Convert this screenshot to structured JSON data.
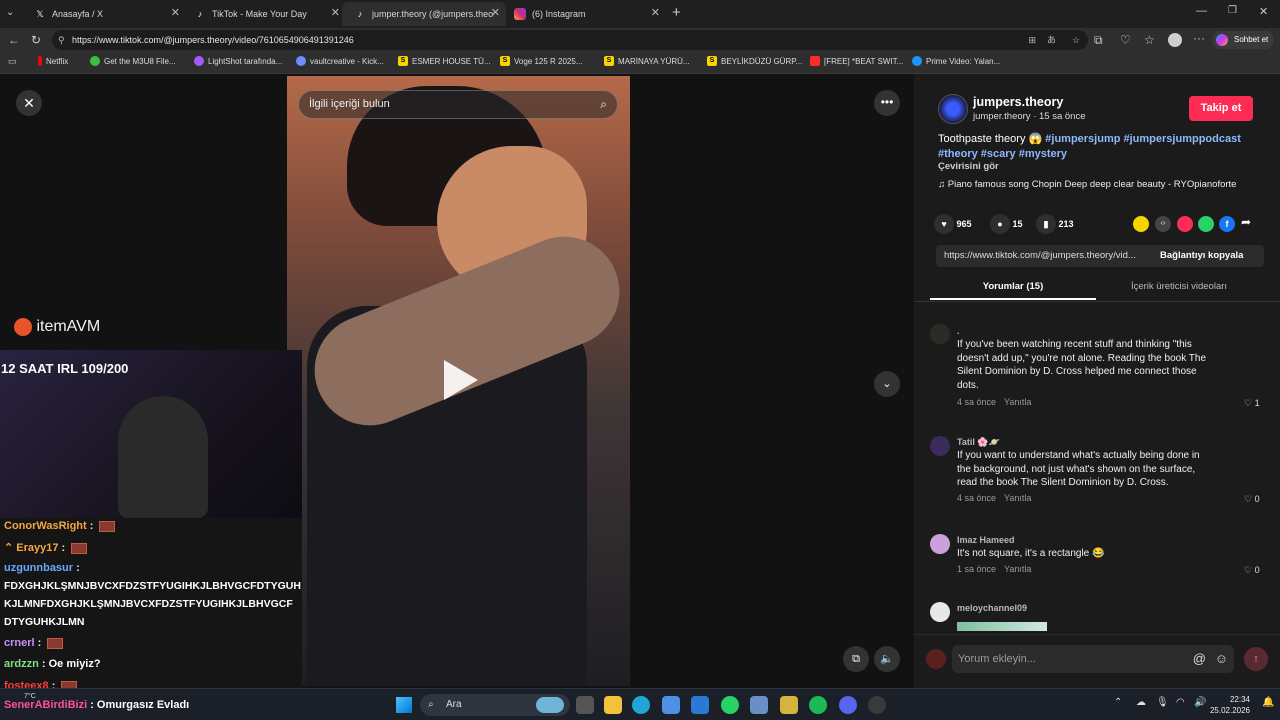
{
  "tabs": [
    {
      "title": "Anasayfa / X",
      "icon": "x-logo"
    },
    {
      "title": "TikTok - Make Your Day",
      "icon": "tiktok-logo"
    },
    {
      "title": "jumper.theory (@jumpers.theory) |",
      "icon": "tiktok-logo",
      "active": true
    },
    {
      "title": "(6) Instagram",
      "icon": "instagram-logo"
    }
  ],
  "address": {
    "url": "https://www.tiktok.com/@jumpers.theory/video/7610654906491391246"
  },
  "copilot": {
    "label": "Sohbet et"
  },
  "bookmarks": [
    {
      "label": "Netflix",
      "color": "#e50914"
    },
    {
      "label": "Get the M3U8 File...",
      "color": "#3fbf3f"
    },
    {
      "label": "LightShot tarafında...",
      "color": "#a259ff"
    },
    {
      "label": "vaultcreative - Kick...",
      "color": "#6c8cff"
    },
    {
      "label": "ESMER HOUSE TÜ...",
      "color": "#f5d400"
    },
    {
      "label": "Voge 125 R 2025...",
      "color": "#f5d400"
    },
    {
      "label": "MARİNAYA YÜRÜ...",
      "color": "#f5d400"
    },
    {
      "label": "BEYLİKDÜZÜ GÜRP...",
      "color": "#f5d400"
    },
    {
      "label": "[FREE] *BEAT SWIT...",
      "color": "#ff2a2a"
    },
    {
      "label": "Prime Video: Yalan...",
      "color": "#1a98ff"
    }
  ],
  "player": {
    "search_placeholder": "İlgili içeriği bulun",
    "watermark": "itemAVM"
  },
  "stream": {
    "title": "12 SAAT IRL 109/200",
    "chat": [
      {
        "user": "ConorWasRight",
        "msg": "",
        "color": "#f4a640",
        "emote": true
      },
      {
        "user": "Erayy17",
        "msg": "",
        "color": "#f4a640",
        "emote": true
      },
      {
        "user": "uzgunnbasur",
        "msg": "",
        "color": "#6aa8ff",
        "emote": false
      },
      {
        "user": "",
        "msg": "FDXGHJKLŞMNJBVCXFDZSTFYUGIHKJLBHVGCFDTYGUH",
        "color": "#ffffff",
        "emote": false
      },
      {
        "user": "",
        "msg": "KJLMNFDXGHJKLŞMNJBVCXFDZSTFYUGIHKJLBHVGCF",
        "color": "#ffffff",
        "emote": false
      },
      {
        "user": "",
        "msg": "DTYGUHKJLMN",
        "color": "#ffffff",
        "emote": false
      },
      {
        "user": "crnerl",
        "msg": "",
        "color": "#c88cff",
        "emote": true
      },
      {
        "user": "ardzzn",
        "msg": "Oe miyiz?",
        "color": "#7fe07f",
        "emote": false
      },
      {
        "user": "fosteex8",
        "msg": "",
        "color": "#ff3b3b",
        "emote": true
      },
      {
        "user": "SenerABirdiBizi",
        "msg": "Omurgasız Evladı",
        "color": "#ff4fa0",
        "emote": false
      }
    ]
  },
  "video": {
    "author": "jumpers.theory",
    "handle_time": "jumper.theory · 15 sa önce",
    "follow_label": "Takip et",
    "caption_text": "Toothpaste theory 😱",
    "hashtags_line1": "#jumpersjump #jumpersjumppodcast",
    "hashtags_line2": "#theory #scary #mystery",
    "see_translation": "Çevirisini gör",
    "music": "Piano famous song Chopin Deep deep clear beauty - RYOpianoforte",
    "likes": "965",
    "comments": "15",
    "saves": "213",
    "share_url": "https://www.tiktok.com/@jumpers.theory/vid...",
    "copy_link": "Bağlantıyı kopyala",
    "tab_comments": "Yorumlar (15)",
    "tab_creator": "İçerik üreticisi videoları",
    "comment_placeholder": "Yorum ekleyin..."
  },
  "comments": [
    {
      "name": ".",
      "lines": [
        "If you've been watching recent stuff and thinking \"this",
        "doesn't add up,\" you're not alone. Reading the book The",
        "Silent Dominion by D. Cross helped me connect those",
        "dots."
      ],
      "time": "4 sa önce",
      "reply": "Yanıtla",
      "likes": "1"
    },
    {
      "name": "Tatil 🌸🪐",
      "lines": [
        "If you want to understand what's actually being done in",
        "the background, not just what's shown on the surface,",
        "read the book The Silent Dominion by D. Cross."
      ],
      "time": "4 sa önce",
      "reply": "Yanıtla",
      "likes": "0"
    },
    {
      "name": "Imaz Hameed",
      "lines": [
        "It's not square, it's a rectangle 😂"
      ],
      "time": "1 sa önce",
      "reply": "Yanıtla",
      "likes": "0"
    },
    {
      "name": "meloychannel09",
      "lines": [],
      "time": "",
      "reply": "",
      "likes": ""
    }
  ],
  "taskbar": {
    "search_label": "Ara",
    "weather": "7°C",
    "time": "22:34",
    "date": "25.02.2026"
  }
}
